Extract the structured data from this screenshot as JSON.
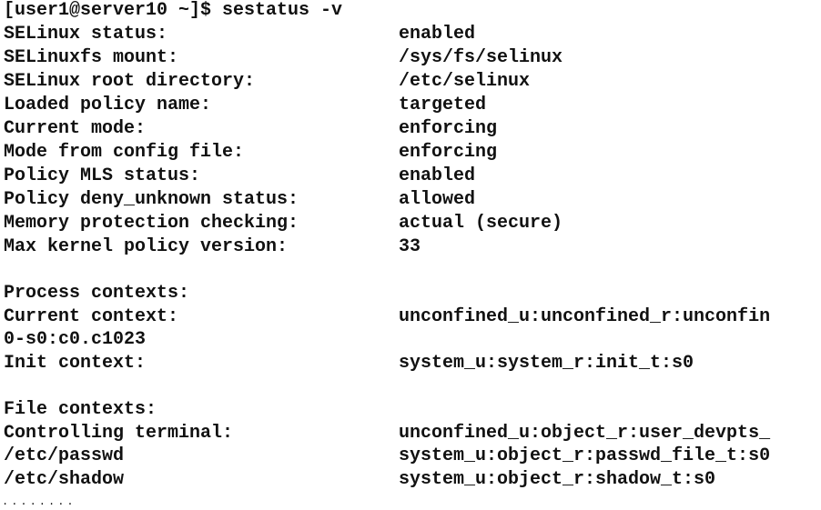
{
  "terminal": {
    "prompt": "[user1@server10 ~]$ sestatus -v",
    "status_rows": [
      {
        "label": "SELinux status:",
        "value": "enabled"
      },
      {
        "label": "SELinuxfs mount:",
        "value": "/sys/fs/selinux"
      },
      {
        "label": "SELinux root directory:",
        "value": "/etc/selinux"
      },
      {
        "label": "Loaded policy name:",
        "value": "targeted"
      },
      {
        "label": "Current mode:",
        "value": "enforcing"
      },
      {
        "label": "Mode from config file:",
        "value": "enforcing"
      },
      {
        "label": "Policy MLS status:",
        "value": "enabled"
      },
      {
        "label": "Policy deny_unknown status:",
        "value": "allowed"
      },
      {
        "label": "Memory protection checking:",
        "value": "actual (secure)"
      },
      {
        "label": "Max kernel policy version:",
        "value": "33"
      }
    ],
    "process_heading": "Process contexts:",
    "current_context_label": "Current context:",
    "current_context_value": "unconfined_u:unconfined_r:unconfin",
    "current_context_wrap": "0-s0:c0.c1023",
    "init_context_label": "Init context:",
    "init_context_value": "system_u:system_r:init_t:s0",
    "file_heading": "File contexts:",
    "file_rows": [
      {
        "label": "Controlling terminal:",
        "value": "unconfined_u:object_r:user_devpts_"
      },
      {
        "label": "/etc/passwd",
        "value": "system_u:object_r:passwd_file_t:s0"
      },
      {
        "label": "/etc/shadow",
        "value": "system_u:object_r:shadow_t:s0"
      }
    ],
    "ellipsis": "........"
  }
}
